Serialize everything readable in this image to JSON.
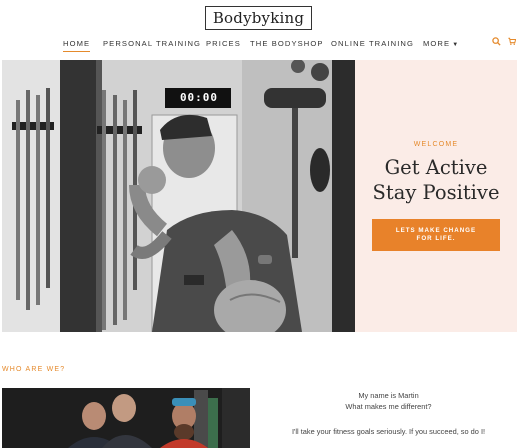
{
  "header": {
    "logo": "Bodybyking"
  },
  "nav": {
    "items": [
      "HOME",
      "PERSONAL TRAINING",
      "PRICES",
      "THE BODYSHOP",
      "ONLINE TRAINING",
      "MORE"
    ],
    "search_icon": "search-icon",
    "cart_icon": "cart-icon"
  },
  "hero": {
    "clock": "00:00",
    "welcome": "WELCOME",
    "headline_line1": "Get Active",
    "headline_line2": "Stay Positive",
    "cta_line1": "LETS MAKE CHANGE",
    "cta_line2": "FOR LIFE."
  },
  "about": {
    "heading": "WHO ARE WE?",
    "line1": "My name is Martin",
    "line2": "What makes me different?",
    "line3": "I'll take your fitness goals seriously. If you succeed, so do I!"
  },
  "colors": {
    "accent": "#e58a2c",
    "hero_panel": "#fbece7"
  }
}
